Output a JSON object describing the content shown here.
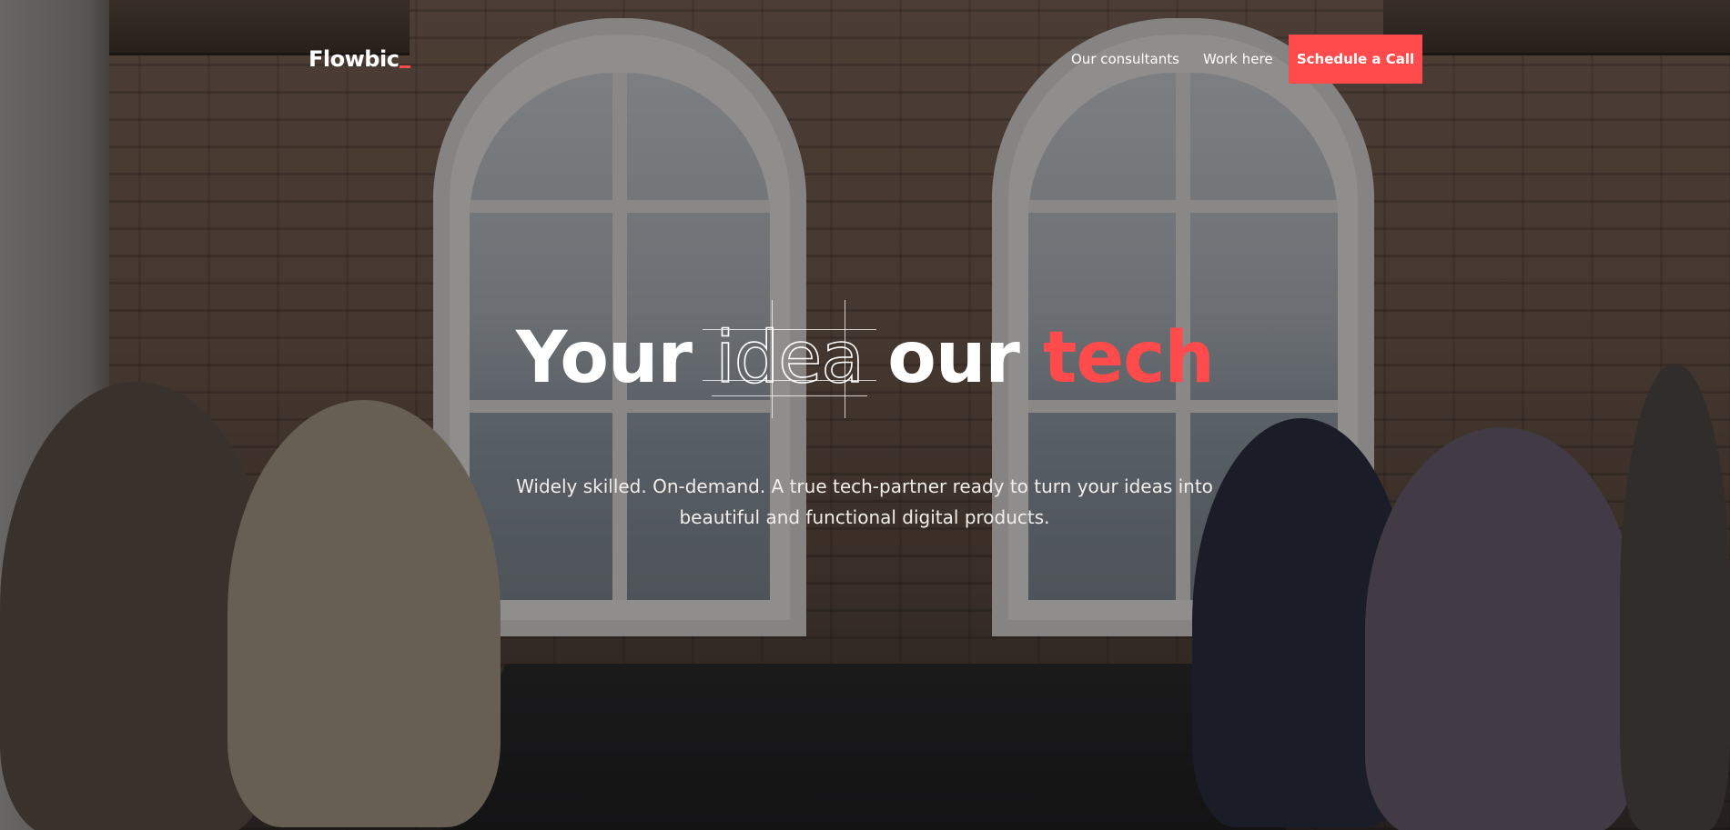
{
  "brand": {
    "name": "Flowbic",
    "accent_color": "#ff4b4b"
  },
  "nav": {
    "links": [
      {
        "label": "Our consultants"
      },
      {
        "label": "Work here"
      }
    ],
    "cta_label": "Schedule a Call"
  },
  "hero": {
    "headline": {
      "word1": "Your",
      "word2": "idea",
      "word3": "our",
      "word4": "tech"
    },
    "subtitle_line1": "Widely skilled. On-demand. A true tech-partner ready to turn your ideas into",
    "subtitle_line2": "beautiful and functional digital products."
  }
}
